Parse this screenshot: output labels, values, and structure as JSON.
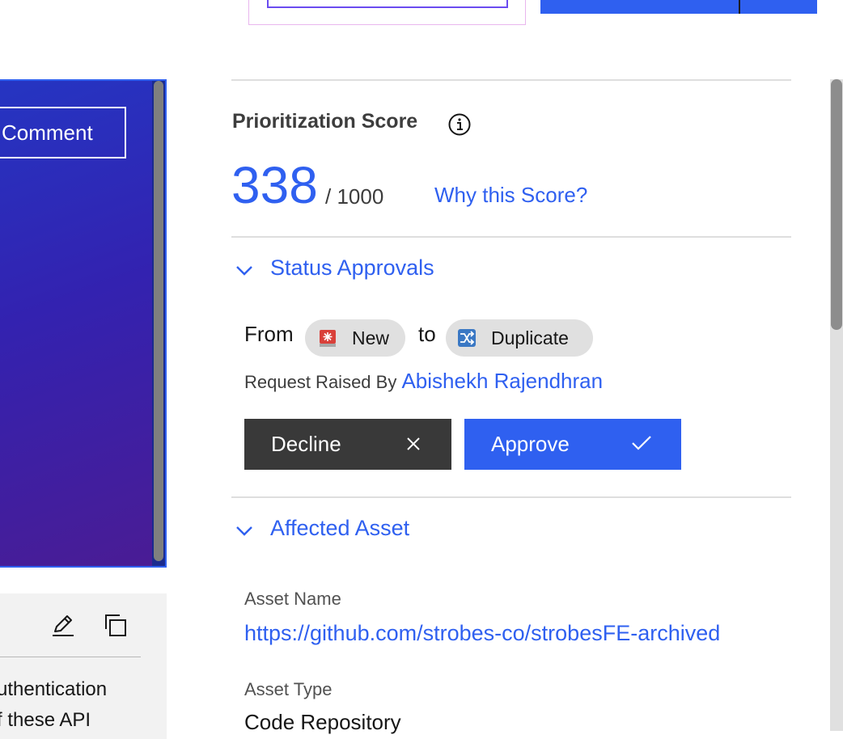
{
  "comment_button": {
    "label": "Comment"
  },
  "card_text": {
    "line1": "uthentication",
    "line2": "f these API"
  },
  "prioritization": {
    "title": "Prioritization Score",
    "score": "338",
    "max": "/ 1000",
    "why_link": "Why this Score?"
  },
  "status_approvals": {
    "heading": "Status Approvals",
    "from_label": "From",
    "from_status": "New",
    "to_label": "to",
    "to_status": "Duplicate",
    "raised_by_label": "Request Raised By",
    "raised_by_name": "Abishekh Rajendhran",
    "decline_label": "Decline",
    "approve_label": "Approve"
  },
  "affected_asset": {
    "heading": "Affected Asset",
    "name_label": "Asset Name",
    "name_value": "https://github.com/strobes-co/strobesFE-archived",
    "type_label": "Asset Type",
    "type_value": "Code Repository"
  },
  "colors": {
    "accent": "#2f60f0",
    "dark_button": "#393939",
    "panel_gradient_start": "#2535c2",
    "panel_gradient_end": "#4a1c94"
  }
}
